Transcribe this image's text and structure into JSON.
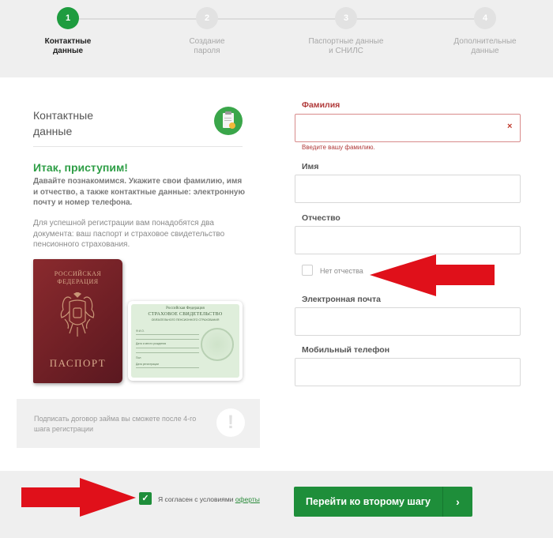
{
  "steps": [
    {
      "number": "1",
      "label": "Контактные\nданные",
      "active": true
    },
    {
      "number": "2",
      "label": "Создание\nпароля",
      "active": false
    },
    {
      "number": "3",
      "label": "Паспортные данные\nи СНИЛС",
      "active": false
    },
    {
      "number": "4",
      "label": "Дополнительные\nданные",
      "active": false
    }
  ],
  "left": {
    "title": "Контактные\nданные",
    "lead_title": "Итак, приступим!",
    "lead_text": "Давайте познакомимся. Укажите свои фамилию, имя и отчество, а также контактные данные: электронную почту и номер телефона.",
    "lead_text2": "Для успешной регистрации вам понадобятся два документа: ваш паспорт и страховое свидетельство пенсионного страхования.",
    "passport": {
      "top": "РОССИЙСКАЯ\nФЕДЕРАЦИЯ",
      "bottom": "ПАСПОРТ"
    },
    "snils": {
      "line1": "Российская Федерация",
      "line2": "СТРАХОВОЕ СВИДЕТЕЛЬСТВО",
      "line3": "ОБЯЗАТЕЛЬНОГО ПЕНСИОННОГО СТРАХОВАНИЯ",
      "label_name": "Ф.И.О.",
      "label_birth": "Дата и место рождения",
      "label_sex": "Пол",
      "label_date": "Дата регистрации"
    },
    "notice_text": "Подписать договор займа вы сможете после 4-го шага регистрации",
    "notice_icon": "!"
  },
  "form": {
    "surname_label": "Фамилия",
    "surname_value": "",
    "surname_error_icon": "×",
    "surname_error": "Введите вашу фамилию.",
    "name_label": "Имя",
    "name_value": "",
    "patronymic_label": "Отчество",
    "patronymic_value": "",
    "no_patronymic_label": "Нет отчества",
    "email_label": "Электронная почта",
    "email_value": "",
    "phone_label": "Мобильный телефон",
    "phone_value": ""
  },
  "footer": {
    "agree_check": "✓",
    "agree_text": "Я согласен с условиями ",
    "agree_link": "оферты",
    "next_label": "Перейти ко второму шагу",
    "next_arrow": "›"
  },
  "colors": {
    "brand_green": "#1e8e3a",
    "error_red": "#b03a3a",
    "annotation_red": "#e0101a"
  },
  "icons": [
    "clipboard-icon",
    "warning-icon",
    "check-icon",
    "chevron-right-icon",
    "clear-error-icon"
  ]
}
